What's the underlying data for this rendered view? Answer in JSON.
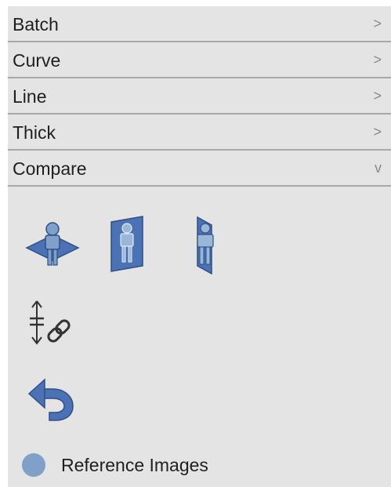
{
  "sections": [
    {
      "label": "Batch",
      "chevron": ">"
    },
    {
      "label": "Curve",
      "chevron": ">"
    },
    {
      "label": "Line",
      "chevron": ">"
    },
    {
      "label": "Thick",
      "chevron": ">"
    },
    {
      "label": "Compare",
      "chevron": "v"
    }
  ],
  "compare": {
    "icons": [
      "horizontal-plane-person-icon",
      "front-plane-person-icon",
      "side-plane-person-icon",
      "link-offset-icon",
      "undo-arrow-icon"
    ],
    "reference_label": "Reference Images",
    "accent_color": "#4a72b4",
    "dot_color": "#7fa0c8"
  }
}
